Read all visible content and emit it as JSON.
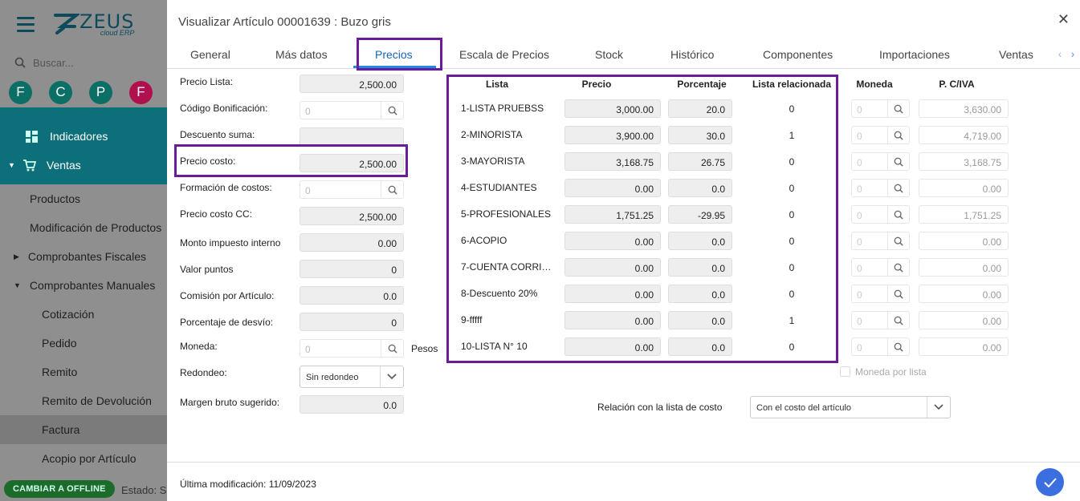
{
  "app": {
    "logo_main": "ZEUS",
    "logo_sub": "cloud ERP"
  },
  "sidebar": {
    "search_placeholder": "Buscar...",
    "shortcuts": [
      {
        "letter": "F",
        "color": "#0c6f66"
      },
      {
        "letter": "C",
        "color": "#0c6f66"
      },
      {
        "letter": "P",
        "color": "#0c6f66"
      },
      {
        "letter": "F",
        "color": "#b0104e"
      }
    ],
    "indicadores": "Indicadores",
    "ventas": "Ventas",
    "items": [
      "Productos",
      "Modificación de Productos",
      "Comprobantes Fiscales",
      "Comprobantes Manuales",
      "Cotización",
      "Pedido",
      "Remito",
      "Remito de Devolución",
      "Factura",
      "Acopio por Artículo"
    ],
    "offline_button": "CAMBIAR A OFFLINE",
    "estado": "Estado: S"
  },
  "modal": {
    "title": "Visualizar Artículo 00001639 : Buzo gris",
    "tabs": [
      "General",
      "Más datos",
      "Precios",
      "Escala de Precios",
      "Stock",
      "Histórico",
      "Componentes",
      "Importaciones",
      "Ventas"
    ],
    "active_tab": "Precios",
    "footer": "Última modificación: 11/09/2023"
  },
  "left_fields": {
    "precio_lista": {
      "label": "Precio Lista:",
      "value": "2,500.00"
    },
    "codigo_bonificacion": {
      "label": "Código Bonificación:",
      "placeholder": "0"
    },
    "descuento_suma": {
      "label": "Descuento suma:",
      "value": ""
    },
    "precio_costo": {
      "label": "Precio costo:",
      "value": "2,500.00"
    },
    "formacion_costos": {
      "label": "Formación de costos:",
      "placeholder": "0"
    },
    "precio_costo_cc": {
      "label": "Precio costo CC:",
      "value": "2,500.00"
    },
    "monto_impuesto": {
      "label": "Monto impuesto interno",
      "value": "0.00"
    },
    "valor_puntos": {
      "label": "Valor puntos",
      "value": "0"
    },
    "comision": {
      "label": "Comisión por Artículo:",
      "value": "0.0"
    },
    "desvio": {
      "label": "Porcentaje de desvío:",
      "value": "0"
    },
    "moneda": {
      "label": "Moneda:",
      "placeholder": "0",
      "suffix": "Pesos"
    },
    "redondeo": {
      "label": "Redondeo:",
      "value": "Sin redondeo"
    },
    "margen": {
      "label": "Margen bruto sugerido:",
      "value": "0.0"
    }
  },
  "price_table": {
    "headers": {
      "lista": "Lista",
      "precio": "Precio",
      "porcentaje": "Porcentaje",
      "relacionada": "Lista relacionada",
      "moneda": "Moneda",
      "civa": "P. C/IVA"
    },
    "rows": [
      {
        "name": "1-LISTA PRUEBSS",
        "precio": "3,000.00",
        "pct": "20.0",
        "rel": "0",
        "moneda": "0",
        "civa": "3,630.00"
      },
      {
        "name": "2-MINORISTA",
        "precio": "3,900.00",
        "pct": "30.0",
        "rel": "1",
        "moneda": "0",
        "civa": "4,719.00"
      },
      {
        "name": "3-MAYORISTA",
        "precio": "3,168.75",
        "pct": "26.75",
        "rel": "0",
        "moneda": "0",
        "civa": "3,168.75"
      },
      {
        "name": "4-ESTUDIANTES",
        "precio": "0.00",
        "pct": "0.0",
        "rel": "0",
        "moneda": "0",
        "civa": "0.00"
      },
      {
        "name": "5-PROFESIONALES",
        "precio": "1,751.25",
        "pct": "-29.95",
        "rel": "0",
        "moneda": "0",
        "civa": "1,751.25"
      },
      {
        "name": "6-ACOPIO",
        "precio": "0.00",
        "pct": "0.0",
        "rel": "0",
        "moneda": "0",
        "civa": "0.00"
      },
      {
        "name": "7-CUENTA CORRI…",
        "precio": "0.00",
        "pct": "0.0",
        "rel": "0",
        "moneda": "0",
        "civa": "0.00"
      },
      {
        "name": "8-Descuento 20%",
        "precio": "0.00",
        "pct": "0.0",
        "rel": "0",
        "moneda": "0",
        "civa": "0.00"
      },
      {
        "name": "9-fffff",
        "precio": "0.00",
        "pct": "0.0",
        "rel": "1",
        "moneda": "0",
        "civa": "0.00"
      },
      {
        "name": "10-LISTA N° 10",
        "precio": "0.00",
        "pct": "0.0",
        "rel": "0",
        "moneda": "0",
        "civa": "0.00"
      }
    ],
    "moneda_por_lista": "Moneda por lista",
    "relacion_label": "Relación con la lista de costo",
    "relacion_value": "Con el costo del artículo"
  },
  "colors": {
    "accent": "#1e88e5",
    "highlight": "#6a1b9a",
    "sidebar_teal": "#0c6f79"
  }
}
